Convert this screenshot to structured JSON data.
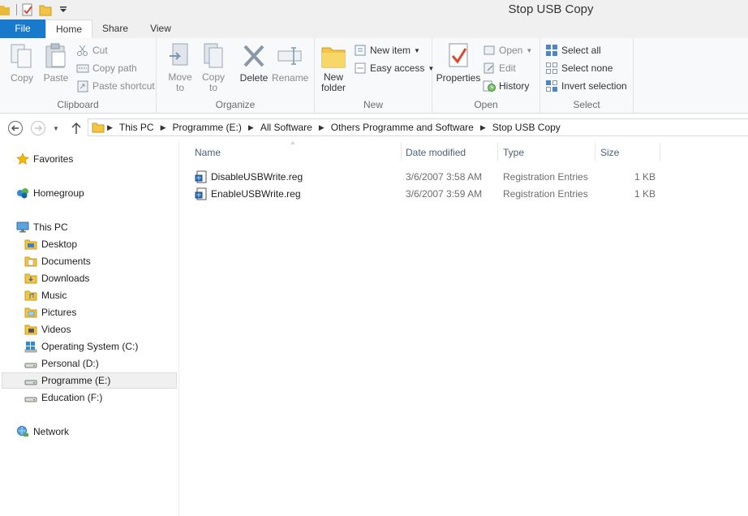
{
  "window": {
    "title": "Stop USB Copy"
  },
  "tabs": {
    "file": "File",
    "home": "Home",
    "share": "Share",
    "view": "View"
  },
  "ribbon": {
    "clipboard": {
      "label": "Clipboard",
      "copy": "Copy",
      "paste": "Paste",
      "cut": "Cut",
      "copy_path": "Copy path",
      "paste_shortcut": "Paste shortcut"
    },
    "organize": {
      "label": "Organize",
      "move_to_1": "Move",
      "move_to_2": "to",
      "copy_to_1": "Copy",
      "copy_to_2": "to",
      "delete": "Delete",
      "rename": "Rename"
    },
    "new": {
      "label": "New",
      "new_folder_1": "New",
      "new_folder_2": "folder",
      "new_item": "New item",
      "easy_access": "Easy access"
    },
    "open": {
      "label": "Open",
      "properties": "Properties",
      "open": "Open",
      "edit": "Edit",
      "history": "History"
    },
    "select": {
      "label": "Select",
      "select_all": "Select all",
      "select_none": "Select none",
      "invert_selection": "Invert selection"
    }
  },
  "address": {
    "crumbs": [
      "This PC",
      "Programme (E:)",
      "All Software",
      "Others Programme and Software",
      "Stop USB Copy"
    ]
  },
  "nav": {
    "favorites": "Favorites",
    "homegroup": "Homegroup",
    "this_pc": "This PC",
    "desktop": "Desktop",
    "documents": "Documents",
    "downloads": "Downloads",
    "music": "Music",
    "pictures": "Pictures",
    "videos": "Videos",
    "drive_c": "Operating System (C:)",
    "drive_d": "Personal (D:)",
    "drive_e": "Programme (E:)",
    "drive_f": "Education (F:)",
    "network": "Network"
  },
  "columns": {
    "name": "Name",
    "date": "Date modified",
    "type": "Type",
    "size": "Size"
  },
  "files": [
    {
      "name": "DisableUSBWrite.reg",
      "date": "3/6/2007 3:58 AM",
      "type": "Registration Entries",
      "size": "1 KB"
    },
    {
      "name": "EnableUSBWrite.reg",
      "date": "3/6/2007 3:59 AM",
      "type": "Registration Entries",
      "size": "1 KB"
    }
  ],
  "colors": {
    "accent": "#1979ca",
    "folder": "#f4c542",
    "header_text": "#4c607a"
  }
}
